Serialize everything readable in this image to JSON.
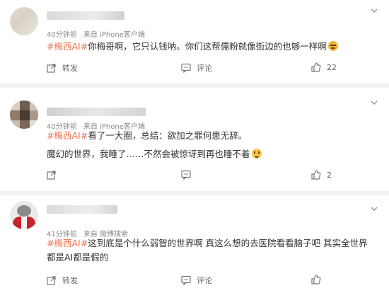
{
  "posts": [
    {
      "meta": {
        "time": "40分钟前",
        "source": "来自 iPhone客户端"
      },
      "hashtag": "#梅西AI#",
      "text": "你梅哥啊，它只认钱呐。你们这帮儒粉就像街边的也够一样啊",
      "emoji": "angry-emoji",
      "actions": {
        "share": "转发",
        "comment": "评论",
        "like_count": "22"
      }
    },
    {
      "meta": {
        "time": "40分钟前",
        "source": "来自 iPhone客户端"
      },
      "hashtag": "#梅西AI#",
      "text": "看了一大圈，总结：欲加之罪何患无辞。",
      "text2": "魔幻的世界，我睡了……不然会被惊讶到再也睡不着",
      "emoji": "smile-emoji",
      "actions": {
        "share": "",
        "comment": "",
        "like_count": "2"
      }
    },
    {
      "meta": {
        "time": "41分钟前",
        "source": "来自 微博搜索"
      },
      "hashtag": "#梅西AI#",
      "text": "这到底是个什么弱智的世界啊 真这么想的去医院看看脑子吧 其实全世界都是AI都是假的",
      "actions": {
        "share": "转发",
        "comment": "评论",
        "like_count": ""
      }
    }
  ],
  "colors": {
    "hashtag": "#eb7350",
    "meta": "#8a8a8a",
    "background": "#f2f2f2"
  }
}
